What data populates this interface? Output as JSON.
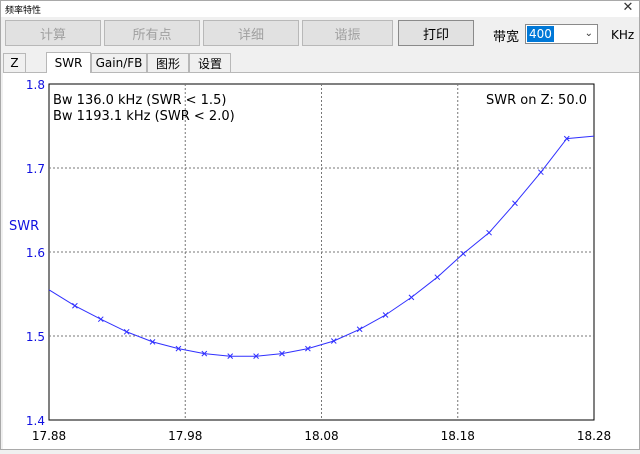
{
  "window": {
    "title": "频率特性",
    "close_icon": "close-icon"
  },
  "toolbar": {
    "calc_label": "计算",
    "all_points_label": "所有点",
    "detail_label": "详细",
    "resonance_label": "谐振",
    "print_label": "打印",
    "bandwidth_label": "带宽",
    "bandwidth_value": "400",
    "bandwidth_unit": "KHz"
  },
  "tabs": [
    {
      "label": "Z"
    },
    {
      "label": "SWR",
      "active": true
    },
    {
      "label": "Gain/FB"
    },
    {
      "label": "图形"
    },
    {
      "label": "设置"
    }
  ],
  "plot": {
    "info_line1": "Bw 136.0 kHz (SWR < 1.5)",
    "info_line2": "Bw 1193.1 kHz (SWR < 2.0)",
    "z_label": "SWR on Z: 50.0"
  },
  "chart_data": {
    "type": "line",
    "title": "",
    "xlabel": "",
    "ylabel": "SWR",
    "xlim": [
      17.88,
      18.28
    ],
    "ylim": [
      1.4,
      1.8
    ],
    "x_ticks": [
      "17.88",
      "17.98",
      "18.08",
      "18.18",
      "18.28"
    ],
    "y_ticks": [
      "1.4",
      "1.5",
      "1.6",
      "1.7",
      "1.8"
    ],
    "grid": true,
    "line_color": "#3030ff",
    "series": [
      {
        "x": [
          17.88,
          17.899,
          17.918,
          17.937,
          17.956,
          17.975,
          17.994,
          18.013,
          18.032,
          18.051,
          18.07,
          18.089,
          18.108,
          18.127,
          18.146,
          18.165,
          18.184,
          18.203,
          18.222,
          18.241,
          18.26,
          18.28
        ],
        "y": [
          1.555,
          1.536,
          1.52,
          1.505,
          1.493,
          1.485,
          1.479,
          1.476,
          1.476,
          1.479,
          1.485,
          1.494,
          1.508,
          1.525,
          1.546,
          1.57,
          1.598,
          1.623,
          1.658,
          1.695,
          1.735,
          1.738
        ]
      }
    ]
  }
}
